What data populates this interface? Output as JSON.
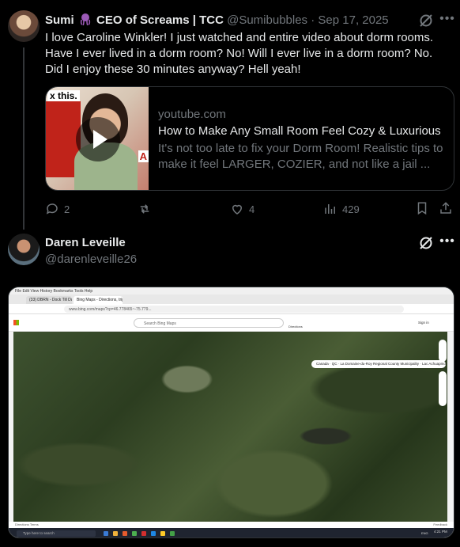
{
  "post1": {
    "display_name_a": "Sumi",
    "display_name_b": "CEO of Screams | TCC",
    "handle": "@Sumibubbles",
    "separator": "·",
    "date": "Sep 17, 2025",
    "text": "I love Caroline Winkler! I just watched and entire video about dorm rooms. Have I ever lived in a dorm room? No! Will I ever live in a dorm room? No. Did I enjoy these 30 minutes anyway? Hell yeah!",
    "card": {
      "domain": "youtube.com",
      "title": "How to Make Any Small Room Feel Cozy & Luxurious",
      "description": "It's not too late to fix your Dorm Room! Realistic tips to make it feel LARGER, COZIER, and not like a jail ...",
      "thumb_sticker": "x this.",
      "thumb_letter": "A"
    },
    "actions": {
      "replies": "2",
      "reposts": "",
      "likes": "4",
      "views": "429"
    }
  },
  "post2": {
    "display_name": "Daren Leveille",
    "handle": "@darenleveille26",
    "screenshot": {
      "menu": "File  Edit  View  History  Bookmarks  Tools  Help",
      "tab1": "(33) DBRN - Dock Till Dawn",
      "tab2": "Bing Maps - Directions, trip pla",
      "url": "www.bing.com/maps?cp=46.778465~-75.779...",
      "search_placeholder": "Search Bing Maps",
      "directions": "Directions",
      "signin": "Sign in",
      "location": "Canada · QC · La Domaine-du-Roy Regional County Municipality · Lac Achuapmouchuan",
      "status_left": "Directions   Terms",
      "status_right": "Feedback",
      "taskbar_search": "Type here to search",
      "time": "4:21 PM",
      "lang": "ENG"
    }
  },
  "colors": {
    "background": "#000000",
    "text": "#e7e9ea",
    "muted": "#71767b",
    "border": "#2f3336",
    "octopus": "#9b59b6"
  }
}
